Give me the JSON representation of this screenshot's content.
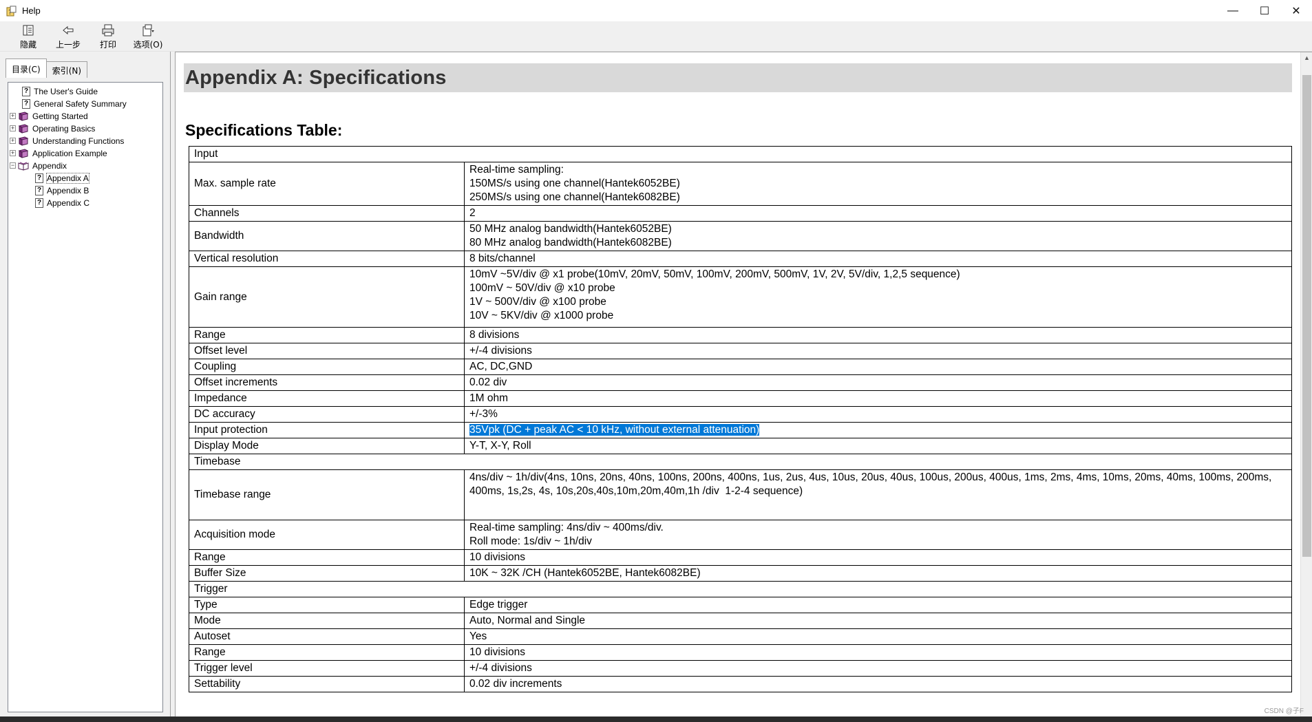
{
  "window": {
    "title": "Help",
    "controls": {
      "minimize": "—",
      "maximize": "☐",
      "close": "✕"
    }
  },
  "toolbar": {
    "hide_label": "隐藏",
    "back_label": "上一步",
    "print_label": "打印",
    "options_label": "选项(O)"
  },
  "nav_tabs": {
    "contents": "目录(C)",
    "index": "索引(N)"
  },
  "tree": [
    {
      "label": "The User's Guide",
      "type": "page",
      "level": 0
    },
    {
      "label": "General Safety Summary",
      "type": "page",
      "level": 0
    },
    {
      "label": "Getting Started",
      "type": "book",
      "level": 0,
      "expander": "+"
    },
    {
      "label": "Operating Basics",
      "type": "book",
      "level": 0,
      "expander": "+"
    },
    {
      "label": "Understanding Functions",
      "type": "book",
      "level": 0,
      "expander": "+"
    },
    {
      "label": "Application Example",
      "type": "book",
      "level": 0,
      "expander": "+"
    },
    {
      "label": "Appendix",
      "type": "book-open",
      "level": 0,
      "expander": "−"
    },
    {
      "label": "Appendix A",
      "type": "page",
      "level": 1,
      "selected": true
    },
    {
      "label": "Appendix B",
      "type": "page",
      "level": 1
    },
    {
      "label": "Appendix C",
      "type": "page",
      "level": 1
    }
  ],
  "page": {
    "title": "Appendix A: Specifications",
    "subtitle": "Specifications Table:"
  },
  "spec_table": {
    "input_header": "Input",
    "rows_input": [
      {
        "name": "Max. sample rate",
        "lines": [
          "Real-time sampling:",
          "150MS/s using one channel(Hantek6052BE)",
          "250MS/s using one channel(Hantek6082BE)"
        ]
      },
      {
        "name": "Channels",
        "lines": [
          "2"
        ]
      },
      {
        "name": "Bandwidth",
        "lines": [
          "50 MHz analog bandwidth(Hantek6052BE)",
          "80 MHz analog bandwidth(Hantek6082BE)"
        ]
      },
      {
        "name": "Vertical resolution",
        "lines": [
          "8 bits/channel"
        ]
      },
      {
        "name": "Gain range",
        "lines": [
          "10mV ~5V/div @ x1 probe(10mV, 20mV, 50mV, 100mV, 200mV, 500mV, 1V, 2V, 5V/div, 1,2,5 sequence)",
          "100mV ~ 50V/div @ x10 probe",
          "1V ~ 500V/div @ x100 probe",
          "10V ~ 5KV/div @ x1000 probe"
        ]
      },
      {
        "name": "Range",
        "lines": [
          "8 divisions"
        ]
      },
      {
        "name": "Offset level",
        "lines": [
          "+/-4 divisions"
        ]
      },
      {
        "name": "Coupling",
        "lines": [
          "AC, DC,GND"
        ]
      },
      {
        "name": "Offset increments",
        "lines": [
          "0.02 div"
        ]
      },
      {
        "name": "Impedance",
        "lines": [
          "1M ohm"
        ]
      },
      {
        "name": "DC accuracy",
        "lines": [
          "+/-3%"
        ]
      },
      {
        "name": "Input protection",
        "lines": [
          "35Vpk (DC + peak AC < 10 kHz, without external attenuation)"
        ],
        "selected": true
      },
      {
        "name": "Display Mode",
        "lines": [
          "Y-T, X-Y, Roll"
        ]
      }
    ],
    "timebase_header": "Timebase",
    "rows_timebase": [
      {
        "name": "Timebase range",
        "lines": [
          "4ns/div ~ 1h/div(4ns, 10ns, 20ns, 40ns, 100ns, 200ns, 400ns, 1us, 2us, 4us, 10us, 20us, 40us, 100us, 200us, 400us, 1ms, 2ms, 4ms, 10ms, 20ms, 40ms, 100ms, 200ms,",
          "400ms, 1s,2s, 4s, 10s,20s,40s,10m,20m,40m,1h /div  1-2-4 sequence)"
        ]
      },
      {
        "name": "Acquisition mode",
        "lines": [
          "Real-time sampling: 4ns/div ~ 400ms/div.",
          "Roll mode: 1s/div ~ 1h/div"
        ]
      },
      {
        "name": "Range",
        "lines": [
          "10 divisions"
        ]
      },
      {
        "name": "Buffer Size",
        "lines": [
          "10K ~ 32K /CH (Hantek6052BE, Hantek6082BE)"
        ]
      }
    ],
    "trigger_header": "Trigger",
    "rows_trigger": [
      {
        "name": "Type",
        "lines": [
          "Edge trigger"
        ]
      },
      {
        "name": "Mode",
        "lines": [
          "Auto, Normal and Single"
        ]
      },
      {
        "name": "Autoset",
        "lines": [
          "Yes"
        ]
      },
      {
        "name": "Range",
        "lines": [
          "10 divisions"
        ]
      },
      {
        "name": "Trigger level",
        "lines": [
          "+/-4 divisions"
        ]
      },
      {
        "name": "Settability",
        "lines": [
          "0.02 div increments"
        ]
      }
    ]
  },
  "watermark": "CSDN @子F"
}
